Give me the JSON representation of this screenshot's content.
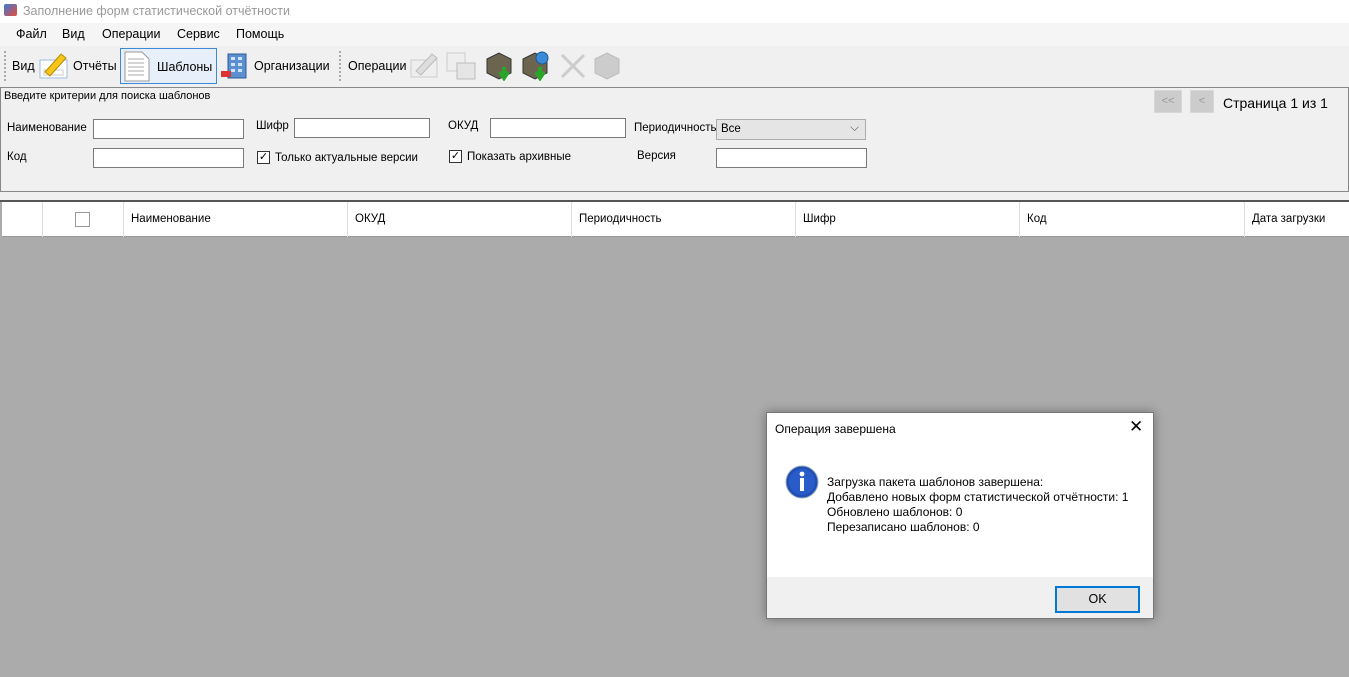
{
  "window": {
    "title": "Заполнение форм статистической отчётности"
  },
  "menu": [
    "Файл",
    "Вид",
    "Операции",
    "Сервис",
    "Помощь"
  ],
  "toolbar": {
    "view_label": "Вид",
    "reports": "Отчёты",
    "templates": "Шаблоны",
    "organizations": "Организации",
    "operations_label": "Операции"
  },
  "search": {
    "caption": "Введите критерии для поиска шаблонов",
    "name_label": "Наименование",
    "name_value": "",
    "cipher_label": "Шифр",
    "cipher_value": "",
    "okud_label": "ОКУД",
    "okud_value": "",
    "periodicity_label": "Периодичность",
    "periodicity_value": "Все",
    "code_label": "Код",
    "code_value": "",
    "only_actual": {
      "label": "Только актуальные версии",
      "checked": true
    },
    "show_archived": {
      "label": "Показать архивные",
      "checked": true
    },
    "version_label": "Версия",
    "version_value": ""
  },
  "pager": {
    "first": "<<",
    "prev": "<",
    "text": "Страница 1 из 1"
  },
  "grid": {
    "columns": [
      "Наименование",
      "ОКУД",
      "Периодичность",
      "Шифр",
      "Код",
      "Дата загрузки"
    ]
  },
  "dialog": {
    "title": "Операция завершена",
    "lines": [
      "Загрузка пакета шаблонов завершена:",
      "Добавлено новых форм статистической отчётности: 1",
      "Обновлено шаблонов: 0",
      "Перезаписано шаблонов: 0"
    ],
    "ok": "OK"
  }
}
